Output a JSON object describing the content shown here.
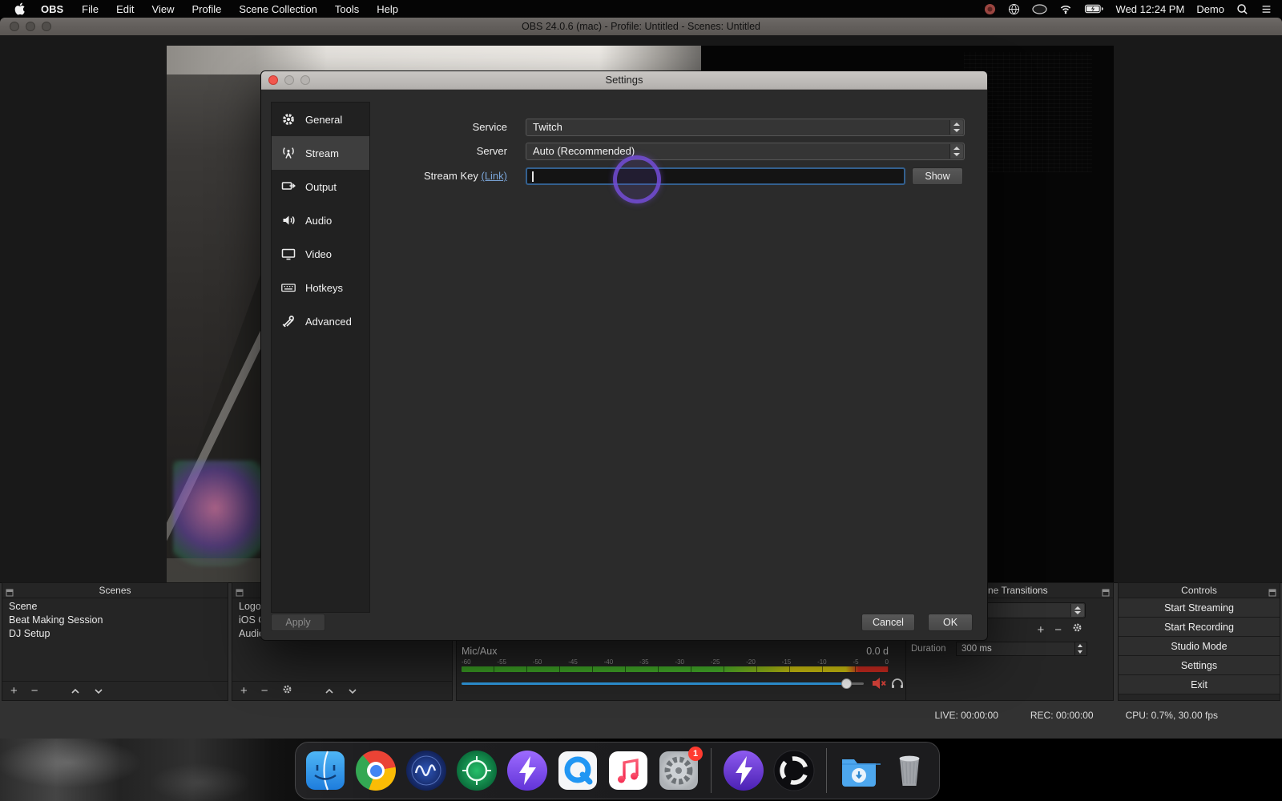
{
  "menubar": {
    "app_name": "OBS",
    "menus": [
      "File",
      "Edit",
      "View",
      "Profile",
      "Scene Collection",
      "Tools",
      "Help"
    ],
    "clock": "Wed 12:24 PM",
    "account": "Demo"
  },
  "window": {
    "title": "OBS 24.0.6 (mac) - Profile: Untitled - Scenes: Untitled"
  },
  "settings": {
    "title": "Settings",
    "nav": [
      {
        "label": "General"
      },
      {
        "label": "Stream"
      },
      {
        "label": "Output"
      },
      {
        "label": "Audio"
      },
      {
        "label": "Video"
      },
      {
        "label": "Hotkeys"
      },
      {
        "label": "Advanced"
      }
    ],
    "form": {
      "service_label": "Service",
      "service_value": "Twitch",
      "server_label": "Server",
      "server_value": "Auto (Recommended)",
      "stream_key_label": "Stream Key",
      "stream_key_link": "(Link)",
      "stream_key_value": "",
      "show_button": "Show"
    },
    "footer": {
      "apply": "Apply",
      "cancel": "Cancel",
      "ok": "OK"
    }
  },
  "scenes": {
    "title": "Scenes",
    "items": [
      "Scene",
      "Beat Making Session",
      "DJ Setup"
    ]
  },
  "sources": {
    "items": [
      "Logo",
      "iOS C",
      "Audio"
    ]
  },
  "mixer": {
    "source": "Mic/Aux",
    "value": "0.0 d",
    "ticks": [
      "-60",
      "-55",
      "-50",
      "-45",
      "-40",
      "-35",
      "-30",
      "-25",
      "-20",
      "-15",
      "-10",
      "-5",
      "0"
    ]
  },
  "transitions": {
    "title": "Scene Transitions",
    "duration_label": "Duration",
    "duration_value": "300 ms"
  },
  "controls": {
    "title": "Controls",
    "buttons": [
      "Start Streaming",
      "Start Recording",
      "Studio Mode",
      "Settings",
      "Exit"
    ]
  },
  "status": {
    "live": "LIVE: 00:00:00",
    "rec": "REC: 00:00:00",
    "cpu": "CPU: 0.7%, 30.00 fps"
  },
  "glyphs": {
    "plus": "+",
    "minus": "−"
  },
  "dock_badge": "1",
  "colors": {
    "accent_purple": "#744ed8",
    "focus_blue": "#33608f",
    "link_blue": "#7aa5d8",
    "mute_red": "#e0453c"
  }
}
